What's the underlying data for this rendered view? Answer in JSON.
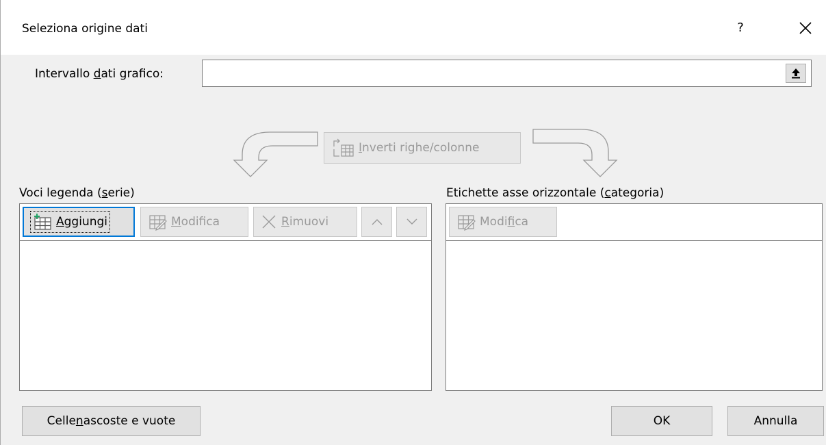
{
  "window": {
    "title": "Seleziona origine dati",
    "help_label": "?"
  },
  "range": {
    "label_pre": "Intervallo ",
    "label_u": "d",
    "label_post": "ati grafico:",
    "value": ""
  },
  "switch": {
    "label_u": "I",
    "label_post": "nverti righe/colonne"
  },
  "legend": {
    "label_pre": "Voci legenda (",
    "label_u": "s",
    "label_post": "erie)",
    "add_u": "A",
    "add_post": "ggiungi",
    "edit_u": "M",
    "edit_post": "odifica",
    "remove_u": "R",
    "remove_post": "imuovi"
  },
  "axis": {
    "label_pre": "Etichette asse orizzontale (",
    "label_u": "c",
    "label_post": "ategoria)",
    "edit_pre": "Modi",
    "edit_u": "f",
    "edit_post": "ica"
  },
  "footer": {
    "hidden_pre": "Celle ",
    "hidden_u": "n",
    "hidden_post": "ascoste e vuote",
    "ok": "OK",
    "cancel": "Annulla"
  },
  "colors": {
    "focus": "#0078d7",
    "disabled_text": "#9a9a9a",
    "add_icon_green": "#21a366"
  },
  "icons": [
    "collapse-dialog-icon",
    "switch-row-col-icon",
    "add-series-icon",
    "edit-series-icon",
    "remove-x-icon",
    "move-up-icon",
    "move-down-icon",
    "close-icon"
  ]
}
